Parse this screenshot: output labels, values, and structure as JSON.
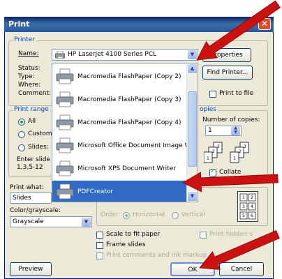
{
  "title": "Print",
  "close_label": "✕",
  "printer": {
    "legend": "Printer",
    "name_label": "Name:",
    "name_accel": "N",
    "name_value": "HP LaserJet 4100 Series PCL",
    "status_label": "Status:",
    "type_label": "Type:",
    "where_label": "Where:",
    "comment_label": "Comment:",
    "properties_label": "Properties",
    "properties_accel": "P",
    "find_printer_label": "Find Printer...",
    "find_printer_accel": "d",
    "print_to_file_label": "Print to file",
    "print_to_file_accel": "l",
    "print_to_file_checked": false
  },
  "printer_list": {
    "items": [
      {
        "label": "Macromedia FlashPaper (Copy 2)",
        "icon": "printer-icon"
      },
      {
        "label": "Macromedia FlashPaper (Copy 3)",
        "icon": "printer-icon"
      },
      {
        "label": "Macromedia FlashPaper (Copy 4)",
        "icon": "printer-icon"
      },
      {
        "label": "Microsoft Office Document Image Writer",
        "icon": "printer-icon"
      },
      {
        "label": "Microsoft XPS Document Writer",
        "icon": "printer-icon"
      },
      {
        "label": "PDFCreator",
        "icon": "printer-icon",
        "selected": true
      }
    ]
  },
  "print_range": {
    "legend": "Print range",
    "all_label": "All",
    "all_accel": "A",
    "custom_label": "Custom S",
    "custom_accel": "u",
    "slides_label": "Slides:",
    "slides_accel": "i",
    "hint_line1": "Enter slide n",
    "hint_line2": "1,3,5-12",
    "selected": "All"
  },
  "copies": {
    "legend": "opies",
    "number_label": "Number of copies:",
    "number_accel": "b",
    "value": "1",
    "collate_label": "Collate",
    "collate_accel": "t",
    "collate_checked": true,
    "pages_a": [
      "1",
      "2",
      "3"
    ],
    "pages_b": [
      "1",
      "2",
      "3"
    ]
  },
  "print_what": {
    "label": "Print what:",
    "accel": "w",
    "value": "Slides"
  },
  "color": {
    "label": "Color/grayscale:",
    "accel": "g",
    "value": "Grayscale"
  },
  "handouts": {
    "order_label": "Order:",
    "horizontal_label": "Horizontal",
    "vertical_label": "Vertical",
    "preview_numbers": [
      "1",
      "2",
      "3",
      "4",
      "5",
      "6"
    ]
  },
  "options": {
    "scale_label": "Scale to fit paper",
    "scale_accel": "f",
    "frame_label": "Frame slides",
    "frame_accel": "m",
    "comments_label": "Print comments and ink markup",
    "hidden_label": "Print hidden s"
  },
  "buttons": {
    "preview_label": "Preview",
    "preview_accel": "e",
    "ok_label": "OK",
    "cancel_label": "Cancel"
  },
  "colors": {
    "arrow": "#cc1111",
    "selection": "#316ac5",
    "title_bar": "#0a246a",
    "dialog_bg": "#ece9d8"
  }
}
